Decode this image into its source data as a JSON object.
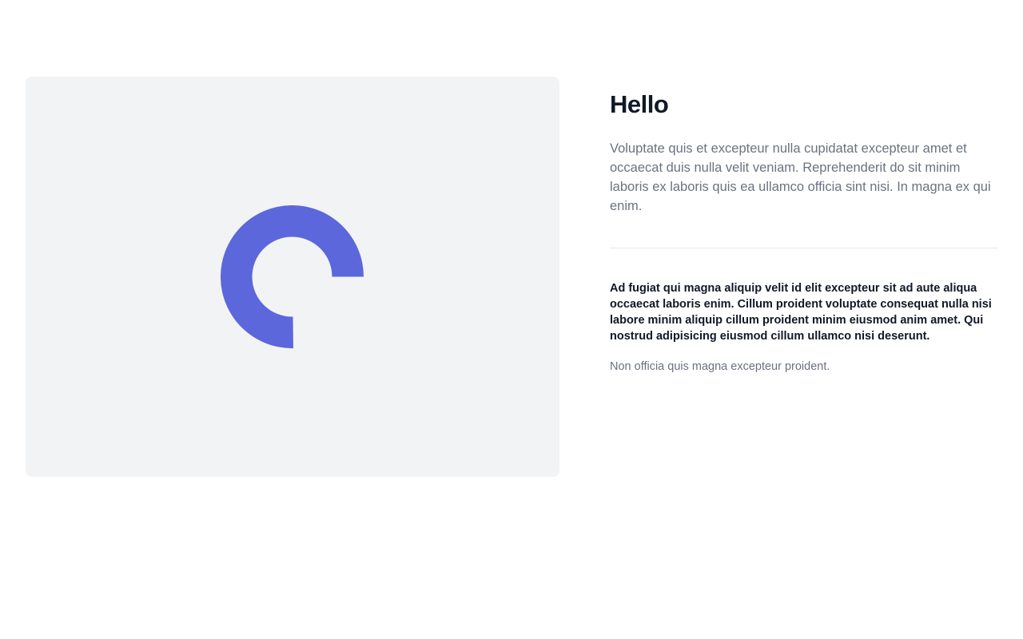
{
  "hero": {
    "logo_icon": "ring-logo-icon",
    "accent_color": "#5c67dc",
    "panel_color": "#f2f3f5"
  },
  "content": {
    "title": "Hello",
    "lead": "Voluptate quis et excepteur nulla cupidatat excepteur amet et occaecat duis nulla velit veniam. Reprehenderit do sit minim laboris ex laboris quis ea ullamco officia sint nisi. In magna ex qui enim.",
    "body": "Ad fugiat qui magna aliquip velit id elit excepteur sit ad aute aliqua occaecat laboris enim. Cillum proident voluptate consequat nulla nisi labore minim aliquip cillum proident minim eiusmod anim amet. Qui nostrud adipisicing eiusmod cillum ullamco nisi deserunt.",
    "note": "Non officia quis magna excepteur proident."
  }
}
